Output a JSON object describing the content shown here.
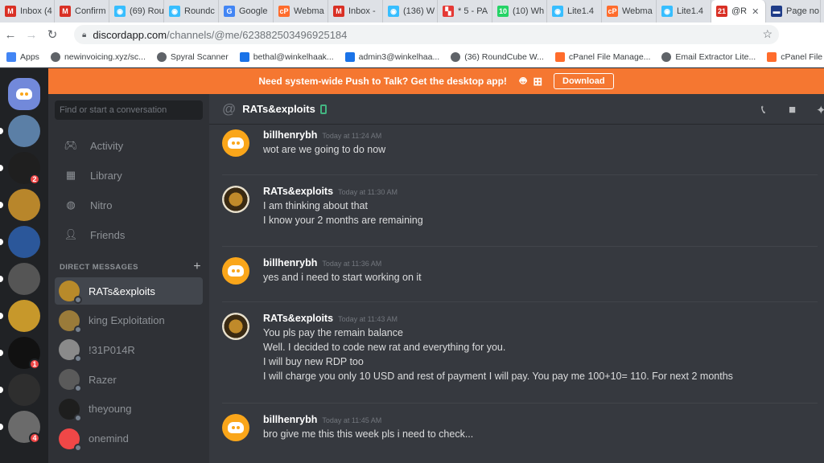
{
  "browser": {
    "tabs": [
      {
        "label": "Inbox (4",
        "icon": "gmail-icon",
        "color": "#d93025",
        "glyph": "M"
      },
      {
        "label": "Confirm",
        "icon": "gmail-icon",
        "color": "#d93025",
        "glyph": "M"
      },
      {
        "label": "(69) Rou",
        "icon": "roundcube-icon",
        "color": "#37beff",
        "glyph": "◉"
      },
      {
        "label": "Roundc",
        "icon": "roundcube-icon",
        "color": "#37beff",
        "glyph": "◉"
      },
      {
        "label": "Google",
        "icon": "google-translate-icon",
        "color": "#4285f4",
        "glyph": "G"
      },
      {
        "label": "Webma",
        "icon": "cpanel-icon",
        "color": "#ff6c2c",
        "glyph": "cP"
      },
      {
        "label": "Inbox -",
        "icon": "gmail-icon",
        "color": "#d93025",
        "glyph": "M"
      },
      {
        "label": "(136) W",
        "icon": "roundcube-icon",
        "color": "#37beff",
        "glyph": "◉"
      },
      {
        "label": "* 5 - PA",
        "icon": "flag-icon",
        "color": "#e53935",
        "glyph": "▚"
      },
      {
        "label": "(10) Wh",
        "icon": "whatsapp-icon",
        "color": "#25d366",
        "glyph": "10"
      },
      {
        "label": "Lite1.4",
        "icon": "roundcube-icon",
        "color": "#37beff",
        "glyph": "◉"
      },
      {
        "label": "Webma",
        "icon": "cpanel-icon",
        "color": "#ff6c2c",
        "glyph": "cP"
      },
      {
        "label": "Lite1.4",
        "icon": "roundcube-icon",
        "color": "#37beff",
        "glyph": "◉"
      },
      {
        "label": "@R",
        "icon": "discord-tab-icon",
        "color": "#d93025",
        "glyph": "21",
        "active": true
      },
      {
        "label": "Page no",
        "icon": "page-icon",
        "color": "#1f3c88",
        "glyph": "▬"
      }
    ],
    "url_host": "discordapp.com",
    "url_path": "/channels/@me/623882503496925184",
    "bookmarks": [
      {
        "label": "Apps",
        "icon": "apps-grid-icon",
        "color": "#4285f4"
      },
      {
        "label": "newinvoicing.xyz/sc...",
        "icon": "globe-icon",
        "color": "#5f6368"
      },
      {
        "label": "Spyral Scanner",
        "icon": "globe-icon",
        "color": "#5f6368"
      },
      {
        "label": "bethal@winkelhaak...",
        "icon": "mail-icon",
        "color": "#1a73e8"
      },
      {
        "label": "admin3@winkelhaa...",
        "icon": "mail-icon",
        "color": "#1a73e8"
      },
      {
        "label": "(36) RoundCube W...",
        "icon": "globe-icon",
        "color": "#5f6368"
      },
      {
        "label": "cPanel File Manage...",
        "icon": "cpanel-icon",
        "color": "#ff6c2c"
      },
      {
        "label": "Email Extractor Lite...",
        "icon": "globe-icon",
        "color": "#5f6368"
      },
      {
        "label": "cPanel File Man",
        "icon": "cpanel-icon",
        "color": "#ff6c2c"
      }
    ]
  },
  "banner": {
    "text": "Need system-wide Push to Talk? Get the desktop app!",
    "download_label": "Download"
  },
  "servers": [
    {
      "name": "discord-home",
      "color": "#7289da",
      "badge": ""
    },
    {
      "name": "server-a",
      "color": "#5b7fa6",
      "badge": ""
    },
    {
      "name": "server-reaper",
      "color": "#1f1f1f",
      "badge": "2"
    },
    {
      "name": "server-leopard",
      "color": "#b8862b",
      "badge": ""
    },
    {
      "name": "server-word",
      "color": "#2b579a",
      "badge": ""
    },
    {
      "name": "server-mask",
      "color": "#555555",
      "badge": ""
    },
    {
      "name": "server-wings",
      "color": "#c7982b",
      "badge": ""
    },
    {
      "name": "server-skull",
      "color": "#111111",
      "badge": "1"
    },
    {
      "name": "server-hacker",
      "color": "#2e2e2e",
      "badge": ""
    },
    {
      "name": "server-grey",
      "color": "#6b6b6b",
      "badge": "4"
    }
  ],
  "sidebar": {
    "search_placeholder": "Find or start a conversation",
    "nav": [
      {
        "label": "Activity",
        "icon": "gamepad-icon"
      },
      {
        "label": "Library",
        "icon": "library-icon"
      },
      {
        "label": "Nitro",
        "icon": "nitro-icon"
      },
      {
        "label": "Friends",
        "icon": "friends-icon"
      }
    ],
    "dm_header": "DIRECT MESSAGES",
    "dms": [
      {
        "name": "RATs&exploits",
        "color": "#b88a2a",
        "active": true
      },
      {
        "name": "king Exploitation",
        "color": "#9a7b3a"
      },
      {
        "name": "!31P014R",
        "color": "#8a8a8a"
      },
      {
        "name": "Razer",
        "color": "#5a5a5a"
      },
      {
        "name": "theyoung",
        "color": "#1e1e1e"
      },
      {
        "name": "onemind",
        "color": "#f04747"
      }
    ]
  },
  "chat": {
    "channel_name": "RATs&exploits",
    "messages": [
      {
        "user": "billhenrybh",
        "time": "Today at 11:24 AM",
        "avatar": "clyde",
        "lines": [
          "wot are we going to do now"
        ]
      },
      {
        "user": "RATs&exploits",
        "time": "Today at 11:30 AM",
        "avatar": "rat",
        "lines": [
          "I am thinking about that",
          "I know your 2 months are remaining"
        ]
      },
      {
        "user": "billhenrybh",
        "time": "Today at 11:36 AM",
        "avatar": "clyde",
        "lines": [
          "yes and i need to start working on it"
        ]
      },
      {
        "user": "RATs&exploits",
        "time": "Today at 11:43 AM",
        "avatar": "rat",
        "lines": [
          "You pls pay the remain balance",
          "Well. I decided to code new rat and everything for you.",
          "I will buy new RDP too",
          "I will charge you only 10 USD and rest of payment I will pay. You pay me 100+10= 110.  For next 2 months"
        ]
      },
      {
        "user": "billhenrybh",
        "time": "Today at 11:45 AM",
        "avatar": "clyde",
        "lines": [
          "bro give me this this week pls i need to check..."
        ]
      }
    ]
  }
}
